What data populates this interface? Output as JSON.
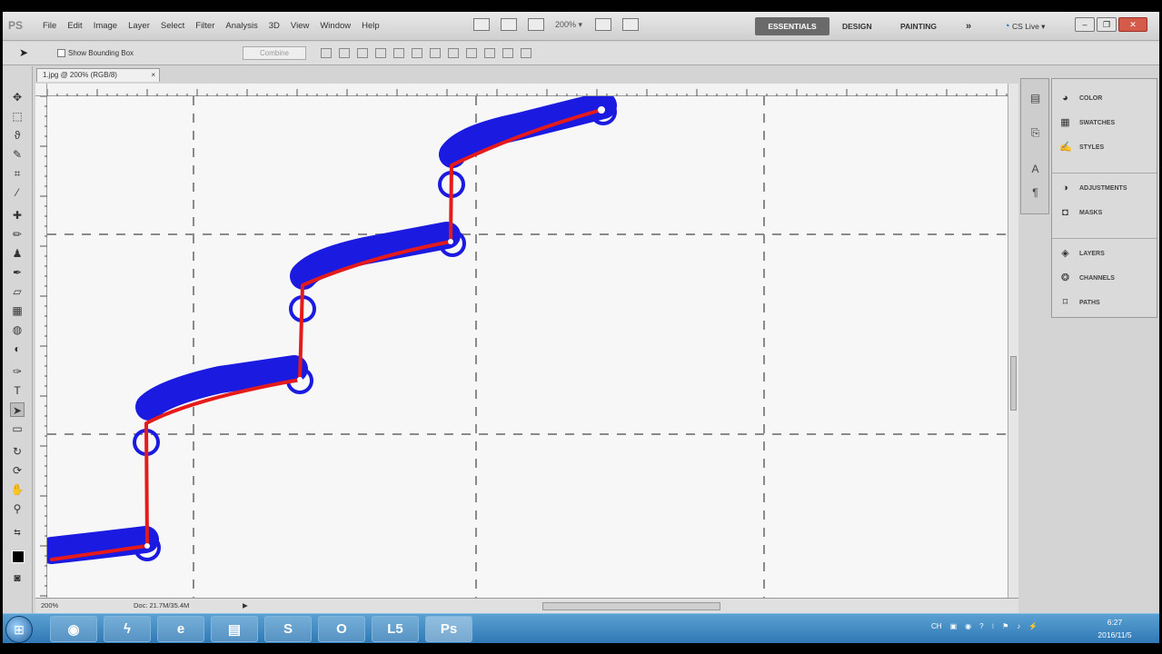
{
  "app": {
    "logo": "PS"
  },
  "menubar": {
    "items": [
      "File",
      "Edit",
      "Image",
      "Layer",
      "Select",
      "Filter",
      "Analysis",
      "3D",
      "View",
      "Window",
      "Help"
    ],
    "zoom": "200%",
    "workspaces": [
      "ESSENTIALS",
      "DESIGN",
      "PAINTING"
    ],
    "more": "»",
    "cslive": "CS Live ▾"
  },
  "options": {
    "show_bounding_box": "Show Bounding Box",
    "combine": "Combine"
  },
  "document": {
    "tab_title": "1.jpg @ 200% (RGB/8)",
    "tab_close": "×"
  },
  "status": {
    "zoom": "200%",
    "doc": "Doc: 21.7M/35.4M",
    "arrow": "▶"
  },
  "panels": {
    "group1": [
      "COLOR",
      "SWATCHES",
      "STYLES"
    ],
    "group2": [
      "ADJUSTMENTS",
      "MASKS"
    ],
    "group3": [
      "LAYERS",
      "CHANNELS",
      "PATHS"
    ]
  },
  "taskbar": {
    "apps": [
      {
        "icon": "chrome-icon",
        "glyph": "◉"
      },
      {
        "icon": "firefox-icon",
        "glyph": "ϟ"
      },
      {
        "icon": "ie-icon",
        "glyph": "e"
      },
      {
        "icon": "folder-icon",
        "glyph": "▤"
      },
      {
        "icon": "skype-icon",
        "glyph": "S"
      },
      {
        "icon": "outlook-icon",
        "glyph": "O"
      },
      {
        "icon": "lightroom-icon",
        "glyph": "L5"
      },
      {
        "icon": "photoshop-icon",
        "glyph": "Ps"
      }
    ],
    "tray_lang": "CH",
    "time": "6:27",
    "date": "2016/11/5"
  },
  "colors": {
    "path_blue": "#1a1ae0",
    "path_red": "#e51b1b",
    "taskbar": "#2f78b5"
  }
}
